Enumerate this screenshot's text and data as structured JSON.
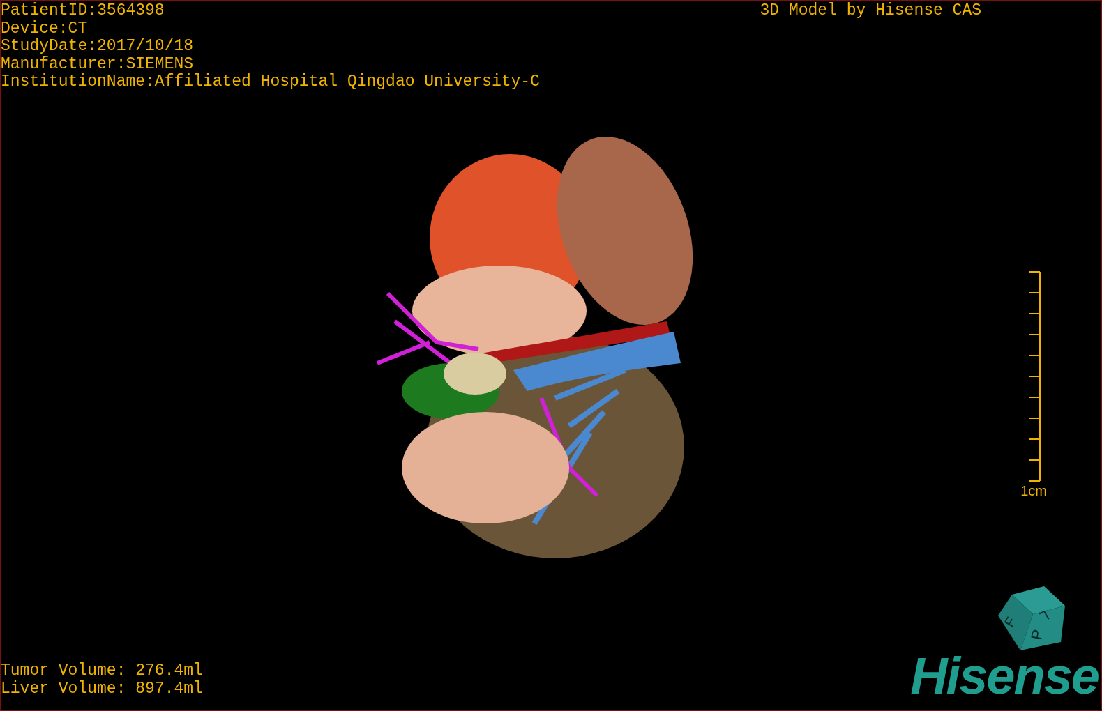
{
  "study_info": [
    {
      "text": "PatientID:3564398"
    },
    {
      "text": "Device:CT"
    },
    {
      "text": "StudyDate:2017/10/18"
    },
    {
      "text": "Manufacturer:SIEMENS"
    },
    {
      "text": "InstitutionName:Affiliated Hospital Qingdao University-C"
    }
  ],
  "model_title": "3D Model by Hisense CAS",
  "scale_bar": {
    "label": "1cm"
  },
  "volumes": [
    {
      "text": "Tumor Volume: 276.4ml"
    },
    {
      "text": "Liver Volume: 897.4ml"
    }
  ],
  "orientation_cube": {
    "faces": [
      "F",
      "L",
      "P"
    ]
  },
  "logo": "Hisense"
}
